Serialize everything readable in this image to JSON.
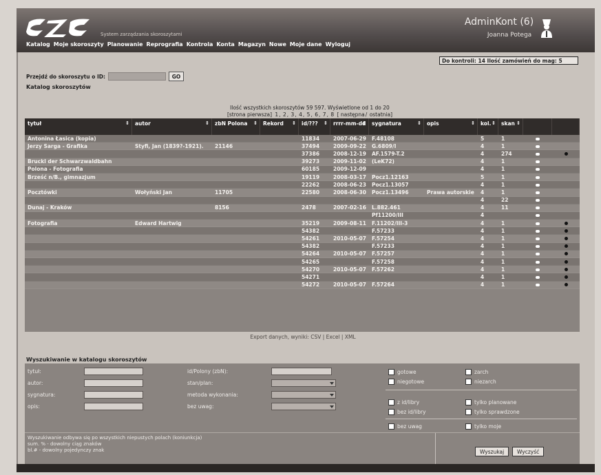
{
  "header": {
    "logo_text": "SZS",
    "tagline": "System zarządzania skoroszytami",
    "account_title": "AdminKont (6)",
    "account_user": "Joanna Potega",
    "nav": [
      "Katalog",
      "Moje skoroszyty",
      "Planowanie",
      "Reprografia",
      "Kontrola",
      "Konta",
      "Magazyn",
      "Nowe",
      "Moje dane",
      "Wyloguj"
    ]
  },
  "status": {
    "to_control_label": "Do kontroli:",
    "to_control_value": "14",
    "orders_label": "Ilość zamówień do mag:",
    "orders_value": "5"
  },
  "goto": {
    "label": "Przejdź do skoroszytu o ID:",
    "button": "GO"
  },
  "catalog_title": "Katalog skoroszytów",
  "summary": {
    "line1": "Ilość wszystkich skoroszytów 59 597. Wyświetlone od 1 do 20",
    "first": "[strona pierwsza]",
    "pages": [
      "1",
      "2",
      "3",
      "4",
      "5",
      "6",
      "7",
      "8"
    ],
    "next": "[ następna",
    "last": "ostatnia]"
  },
  "columns": [
    "tytuł",
    "autor",
    "zbN Polona",
    "Rekord",
    "id/???",
    "rrrr-mm-dd",
    "sygnatura",
    "opis",
    "kol.",
    "skan"
  ],
  "rows": [
    {
      "title": "Antonina Łasica (kopia)",
      "author": "",
      "polona": "",
      "id": "11834",
      "date": "2007-06-29",
      "sig": "F.48108",
      "opis": "",
      "kol": "5",
      "skan": "1",
      "style": "alt",
      "dot": false
    },
    {
      "title": "Jerzy Sarga - Grafika",
      "author": "Styfi, Jan (1839?-1921).",
      "polona": "21146",
      "id": "37494",
      "date": "2009-09-22",
      "sig": "G.6809/I",
      "opis": "",
      "kol": "4",
      "skan": "1",
      "style": "light",
      "dot": false
    },
    {
      "title": "",
      "author": "",
      "polona": "",
      "id": "37386",
      "date": "2008-12-19",
      "sig": "AF.1579-T.2",
      "opis": "",
      "kol": "4",
      "skan": "274",
      "style": "alt",
      "dot": true
    },
    {
      "title": "Bruckl der Schwarzwaldbahn",
      "author": "",
      "polona": "",
      "id": "39273",
      "date": "2009-11-02",
      "sig": "(LeK72)",
      "opis": "",
      "kol": "4",
      "skan": "1",
      "style": "light",
      "dot": false
    },
    {
      "title": "Polona - Fotografia",
      "author": "",
      "polona": "",
      "id": "60185",
      "date": "2009-12-09",
      "sig": "",
      "opis": "",
      "kol": "4",
      "skan": "1",
      "style": "alt",
      "dot": false
    },
    {
      "title": "Brześć n/B., gimnazjum",
      "author": "",
      "polona": "",
      "id": "19119",
      "date": "2008-03-17",
      "sig": "Pocz1.12163",
      "opis": "",
      "kol": "5",
      "skan": "1",
      "style": "light",
      "dot": false
    },
    {
      "title": "",
      "author": "",
      "polona": "",
      "id": "22262",
      "date": "2008-06-23",
      "sig": "Pocz1.13057",
      "opis": "",
      "kol": "4",
      "skan": "1",
      "style": "alt",
      "dot": false
    },
    {
      "title": "Pocztówki",
      "author": "Wołyński Jan",
      "polona": "11705",
      "id": "22580",
      "date": "2008-06-30",
      "sig": "Pocz1.13496",
      "opis": "Prawa autorskie",
      "kol": "4",
      "skan": "1",
      "style": "light",
      "dot": false
    },
    {
      "title": "",
      "author": "",
      "polona": "",
      "id": "",
      "date": "",
      "sig": "",
      "opis": "",
      "kol": "4",
      "skan": "22",
      "style": "alt",
      "dot": false
    },
    {
      "title": "Dunaj - Kraków",
      "author": "",
      "polona": "8156",
      "id": "2478",
      "date": "2007-02-16",
      "sig": "L.882.461",
      "opis": "",
      "kol": "4",
      "skan": "11",
      "style": "light",
      "dot": false
    },
    {
      "title": "",
      "author": "",
      "polona": "",
      "id": "",
      "date": "",
      "sig": "Pf11200/III",
      "opis": "",
      "kol": "4",
      "skan": "",
      "style": "alt",
      "dot": false
    },
    {
      "title": "Fotografia",
      "author": "Edward Hartwig",
      "polona": "",
      "id": "35219",
      "date": "2009-08-11",
      "sig": "F.11202/III-3",
      "opis": "",
      "kol": "4",
      "skan": "1",
      "style": "light",
      "dot": true
    },
    {
      "title": "",
      "author": "",
      "polona": "",
      "id": "54382",
      "date": "",
      "sig": "F.57233",
      "opis": "",
      "kol": "4",
      "skan": "1",
      "style": "alt",
      "dot": true
    },
    {
      "title": "",
      "author": "",
      "polona": "",
      "id": "54261",
      "date": "2010-05-07",
      "sig": "F.57254",
      "opis": "",
      "kol": "4",
      "skan": "1",
      "style": "light",
      "dot": true
    },
    {
      "title": "",
      "author": "",
      "polona": "",
      "id": "54382",
      "date": "",
      "sig": "F.57233",
      "opis": "",
      "kol": "4",
      "skan": "1",
      "style": "alt",
      "dot": true
    },
    {
      "title": "",
      "author": "",
      "polona": "",
      "id": "54264",
      "date": "2010-05-07",
      "sig": "F.57257",
      "opis": "",
      "kol": "4",
      "skan": "1",
      "style": "light",
      "dot": true
    },
    {
      "title": "",
      "author": "",
      "polona": "",
      "id": "54265",
      "date": "",
      "sig": "F.57258",
      "opis": "",
      "kol": "4",
      "skan": "1",
      "style": "alt",
      "dot": true
    },
    {
      "title": "",
      "author": "",
      "polona": "",
      "id": "54270",
      "date": "2010-05-07",
      "sig": "F.57262",
      "opis": "",
      "kol": "4",
      "skan": "1",
      "style": "light",
      "dot": true
    },
    {
      "title": "",
      "author": "",
      "polona": "",
      "id": "54271",
      "date": "",
      "sig": "",
      "opis": "",
      "kol": "4",
      "skan": "1",
      "style": "alt",
      "dot": true
    },
    {
      "title": "",
      "author": "",
      "polona": "",
      "id": "54272",
      "date": "2010-05-07",
      "sig": "F.57264",
      "opis": "",
      "kol": "4",
      "skan": "1",
      "style": "light",
      "dot": true
    }
  ],
  "export": {
    "label": "Export danych, wyniki:",
    "formats": [
      "CSV",
      "Excel",
      "XML"
    ]
  },
  "search": {
    "title": "Wyszukiwanie w katalogu skoroszytów",
    "fields": [
      "tytuł:",
      "autor:",
      "sygnatura:",
      "opis:"
    ],
    "fields2": [
      "id/Polony (zbN):",
      "stan/plan:",
      "metoda wykonania:",
      "bez uwag:"
    ],
    "checks_col1": [
      "gotowe",
      "niegotowe",
      "z id/libry",
      "bez id/libry",
      "bez uwag"
    ],
    "checks_col2": [
      "zarch",
      "niezarch",
      "tylko planowane",
      "tylko sprawdzone",
      "tylko moje"
    ]
  },
  "footer": {
    "note_line1": "Wyszukiwanie odbywa się po wszystkich niepustych polach (koniunkcja)",
    "note_line2": "sum. % - dowolny ciąg znaków",
    "note_line3": "bl.# - dowolny pojedynczy znak",
    "search_button": "Wyszukaj",
    "clear_button": "Wyczyść"
  },
  "colors": {
    "header_bg": "#565050",
    "grid_bg": "#8a8480",
    "grid_head": "#302c2a"
  }
}
